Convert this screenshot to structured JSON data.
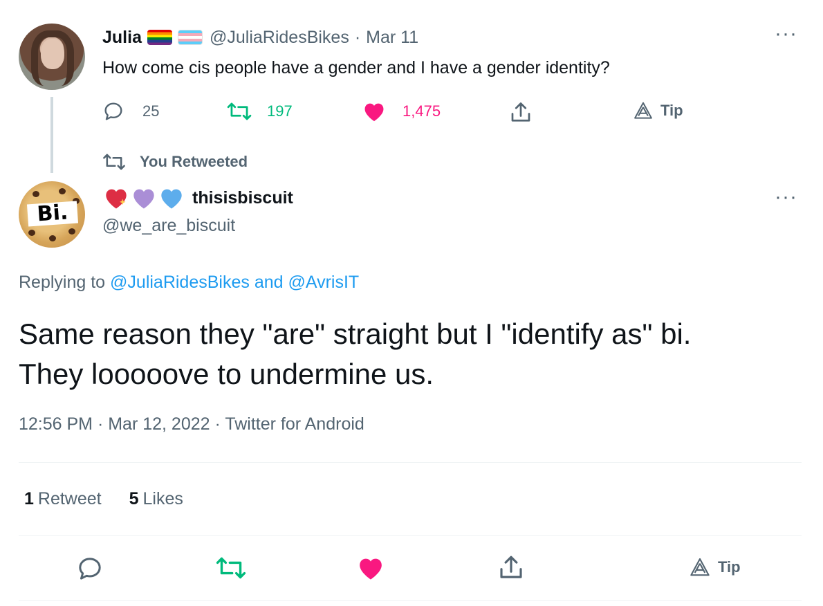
{
  "parent_tweet": {
    "name": "Julia",
    "handle": "@JuliaRidesBikes",
    "date": "Mar 11",
    "separator": "·",
    "more": "···",
    "text": "How come cis people have a gender and I have a gender identity?",
    "reply_count": "25",
    "retweet_count": "197",
    "like_count": "1,475",
    "tip_label": "Tip"
  },
  "retweet_indicator": {
    "label": "You Retweeted"
  },
  "reply_tweet": {
    "name": "thisisbiscuit",
    "handle": "@we_are_biscuit",
    "more": "···",
    "avatar_text": "Bi.",
    "replying_prefix": "Replying to ",
    "replying_to_1": "@JuliaRidesBikes",
    "replying_and": " and ",
    "replying_to_2": "@AvrisIT",
    "text_line_1": "Same reason they \"are\" straight but I \"identify as\" bi.",
    "text_line_2": "They looooove to undermine us.",
    "time": "12:56 PM",
    "date": "Mar 12, 2022",
    "source": "Twitter for Android",
    "separator": " · ",
    "retweets_num": "1",
    "retweets_label": "Retweet",
    "likes_num": "5",
    "likes_label": "Likes",
    "tip_label": "Tip"
  },
  "colors": {
    "text": "#0f1419",
    "muted": "#536471",
    "retweet_green": "#00ba7c",
    "like_pink": "#f91880",
    "link_blue": "#1d9bf0",
    "divider": "#eff3f4"
  },
  "icons": {
    "reply": "reply-icon",
    "retweet": "retweet-icon",
    "like": "heart-icon",
    "share": "share-icon",
    "tip": "tip-icon",
    "name_emojis": [
      "sparkling-heart-icon",
      "purple-heart-icon",
      "blue-heart-icon"
    ],
    "flags": [
      "rainbow-flag-icon",
      "transgender-flag-icon"
    ]
  }
}
